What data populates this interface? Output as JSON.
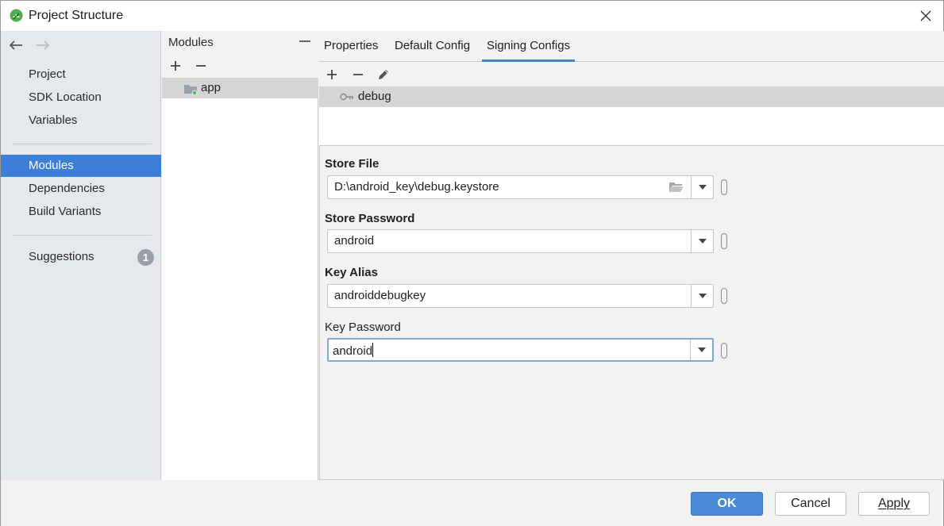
{
  "window": {
    "title": "Project Structure"
  },
  "sidebar": {
    "group1": [
      "Project",
      "SDK Location",
      "Variables"
    ],
    "group2": [
      "Modules",
      "Dependencies",
      "Build Variants"
    ],
    "selected": "Modules",
    "suggestions": {
      "label": "Suggestions",
      "count": "1"
    }
  },
  "modules": {
    "title": "Modules",
    "items": [
      "app"
    ]
  },
  "tabs": [
    "Properties",
    "Default Config",
    "Signing Configs"
  ],
  "active_tab": "Signing Configs",
  "signing_configs": [
    "debug"
  ],
  "form": {
    "store_file": {
      "label": "Store File",
      "value": "D:\\android_key\\debug.keystore"
    },
    "store_password": {
      "label": "Store Password",
      "value": "android"
    },
    "key_alias": {
      "label": "Key Alias",
      "value": "androiddebugkey"
    },
    "key_password": {
      "label": "Key Password",
      "value": "android"
    }
  },
  "buttons": {
    "ok": "OK",
    "cancel": "Cancel",
    "apply": "Apply"
  },
  "colors": {
    "accent": "#3d7fd8",
    "ok_button": "#4a89d6",
    "selection_gray": "#d5d5d5",
    "focus_ring": "#7aa9de"
  },
  "icons": [
    "android-studio-logo",
    "close-icon",
    "back-arrow-icon",
    "forward-arrow-icon",
    "plus-icon",
    "minus-icon",
    "pencil-icon",
    "folder-module-icon",
    "key-icon",
    "open-folder-icon",
    "chevron-down-icon",
    "expand-icon"
  ]
}
